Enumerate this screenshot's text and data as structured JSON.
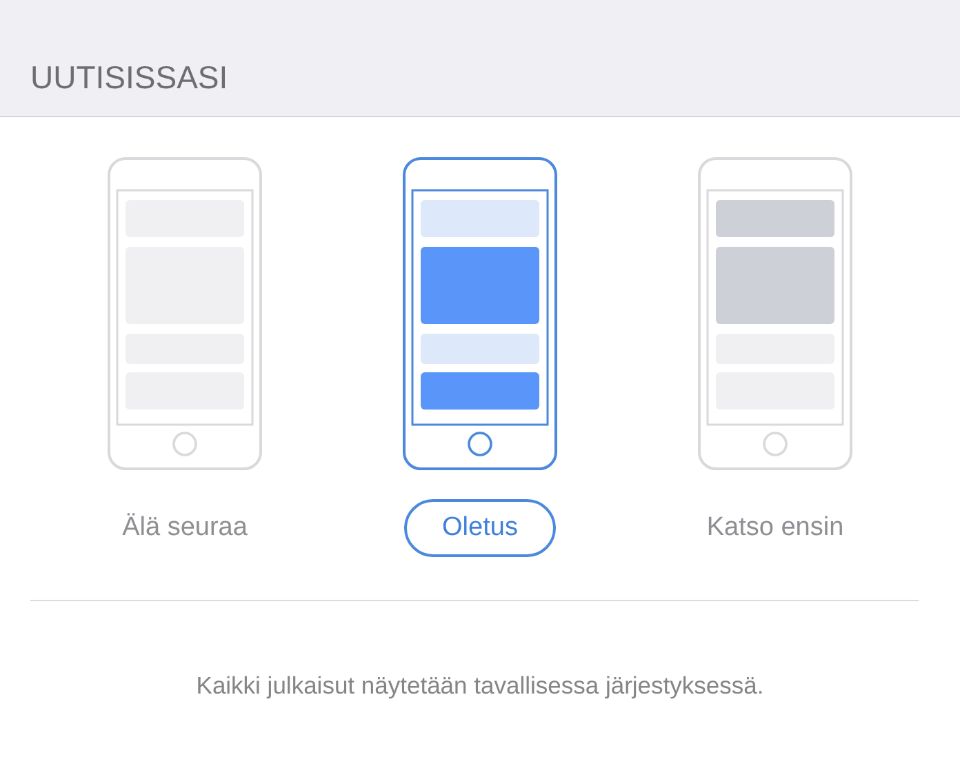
{
  "header": {
    "title": "UUTISISSASI"
  },
  "options": [
    {
      "label": "Älä seuraa",
      "kind": "unfollow",
      "selected": false
    },
    {
      "label": "Oletus",
      "kind": "default",
      "selected": true
    },
    {
      "label": "Katso ensin",
      "kind": "see_first",
      "selected": false
    }
  ],
  "description": "Kaikki julkaisut näytetään tavallisessa järjestyksessä."
}
